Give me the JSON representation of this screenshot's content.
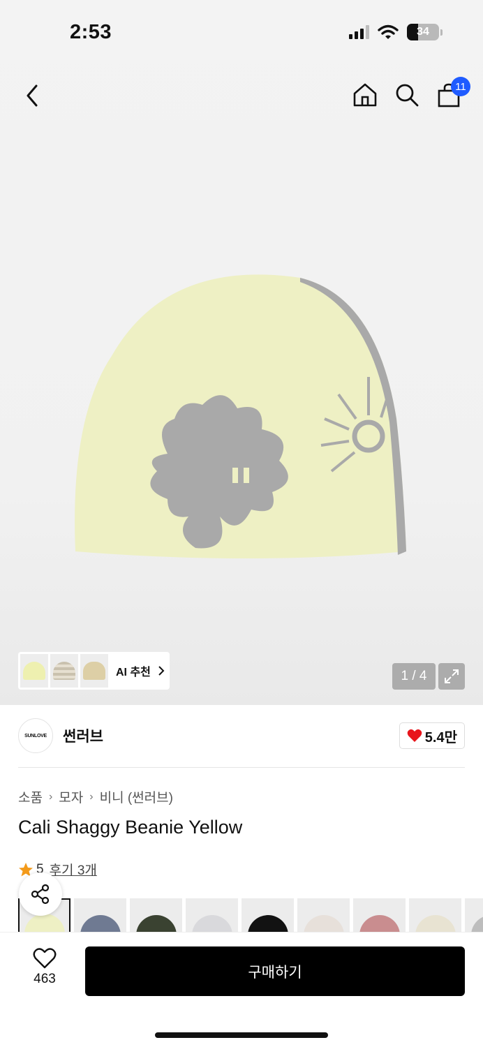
{
  "status_bar": {
    "time": "2:53",
    "battery": "34"
  },
  "nav": {
    "cart_count": "11"
  },
  "gallery": {
    "ai_label": "AI 추천",
    "page_indicator": "1 / 4"
  },
  "brand": {
    "name": "썬러브",
    "logo_text": "SUNLOVE",
    "like_count": "5.4만"
  },
  "breadcrumb": [
    "소품",
    "모자",
    "비니 (썬러브)"
  ],
  "product": {
    "title": "Cali Shaggy Beanie Yellow",
    "rating": "5",
    "reviews": "후기 3개"
  },
  "swatch_colors": [
    "#eef0c4",
    "#6f7a92",
    "#3a4231",
    "#d9d9dc",
    "#121212",
    "#e7e0da",
    "#c98d8f",
    "#e8e3d2",
    "#bdbdbd"
  ],
  "bottom_bar": {
    "wish_count": "463",
    "buy_label": "구매하기"
  },
  "colors": {
    "badge_blue": "#1f5bff",
    "heart_red": "#e8151b",
    "star_orange": "#f39a1a",
    "beanie_yellow": "#eef0c4",
    "pattern_gray": "#a9a9a9"
  }
}
